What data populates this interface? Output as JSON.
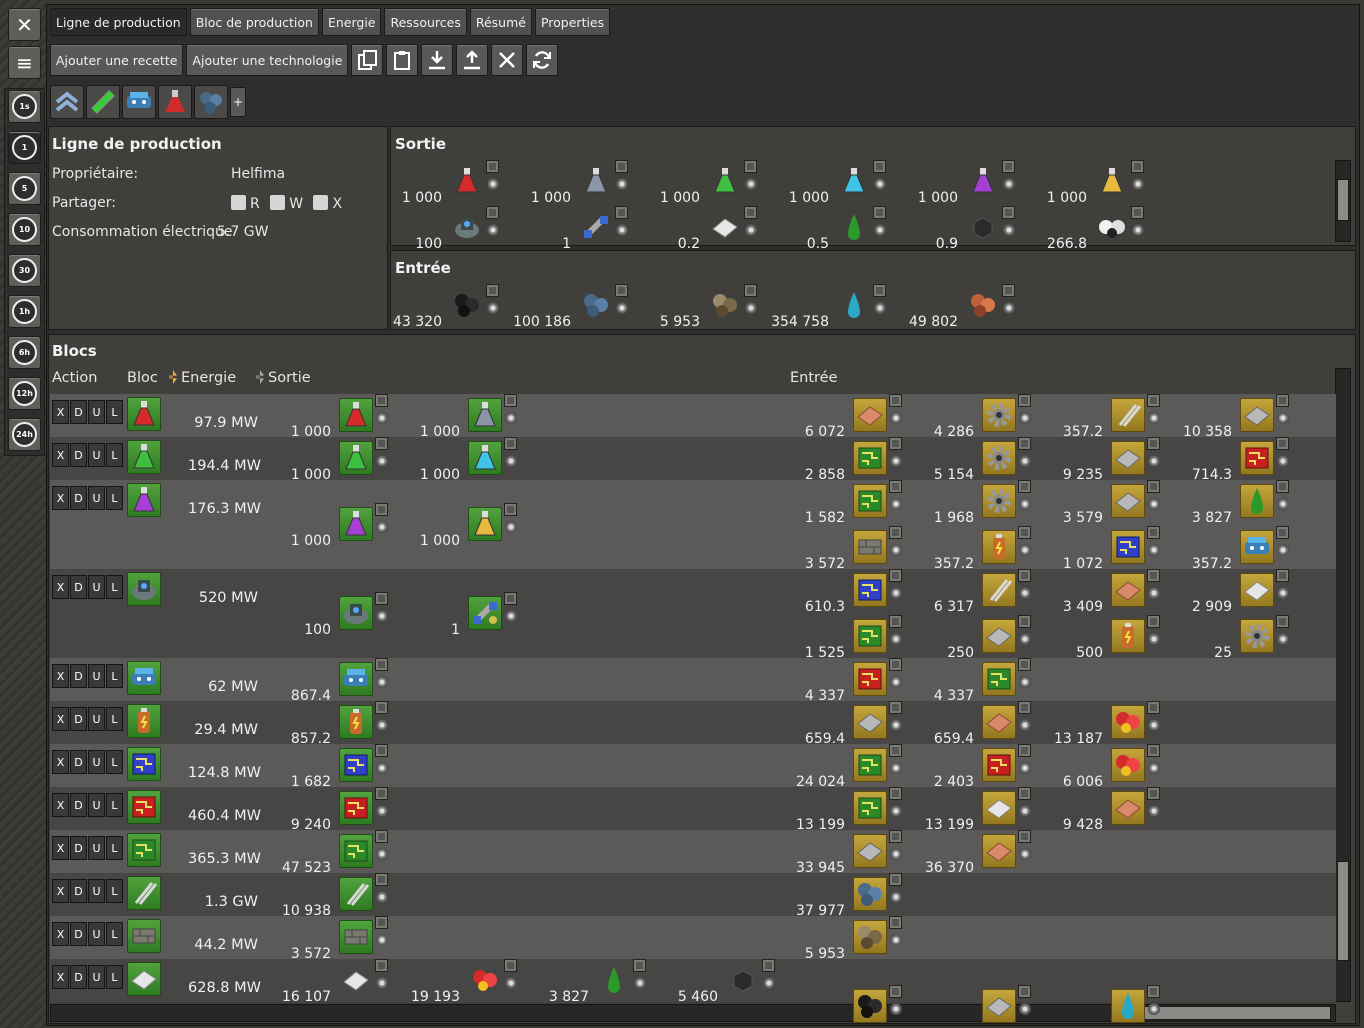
{
  "window": {
    "close_label": "✕",
    "menu_label": "≡"
  },
  "time_buttons": [
    "1s",
    "1",
    "5",
    "10",
    "30",
    "1h",
    "6h",
    "12h",
    "24h"
  ],
  "tabs": [
    "Ligne de production",
    "Bloc de production",
    "Energie",
    "Ressources",
    "Résumé",
    "Properties"
  ],
  "toolbar": {
    "add_recipe": "Ajouter une recette",
    "add_tech": "Ajouter une technologie",
    "plus": "+"
  },
  "info": {
    "title": "Ligne de production",
    "owner_label": "Propriétaire:",
    "owner_value": "Helfima",
    "share_label": "Partager:",
    "share_r": "R",
    "share_w": "W",
    "share_x": "X",
    "power_label": "Consommation électrique",
    "power_value": "5.7 GW"
  },
  "sortie": {
    "title": "Sortie",
    "items": [
      {
        "v": "1 000",
        "icon": "red-science-flask"
      },
      {
        "v": "1 000",
        "icon": "grey-science-flask"
      },
      {
        "v": "1 000",
        "icon": "green-science-flask"
      },
      {
        "v": "1 000",
        "icon": "cyan-science-flask"
      },
      {
        "v": "1 000",
        "icon": "purple-science-flask"
      },
      {
        "v": "1 000",
        "icon": "yellow-science-flask"
      },
      {
        "v": "100",
        "icon": "rocket-silo-icon"
      },
      {
        "v": "1",
        "icon": "satellite-icon"
      },
      {
        "v": "0.2",
        "icon": "steel-plate-icon"
      },
      {
        "v": "0.5",
        "icon": "green-droplet-icon"
      },
      {
        "v": "0.9",
        "icon": "dark-cube-icon"
      },
      {
        "v": "266.8",
        "icon": "white-balls-icon"
      }
    ]
  },
  "entree": {
    "title": "Entrée",
    "items": [
      {
        "v": "43 320",
        "icon": "coal-icon"
      },
      {
        "v": "100 186",
        "icon": "iron-ore-icon"
      },
      {
        "v": "5 953",
        "icon": "stone-icon"
      },
      {
        "v": "354 758",
        "icon": "water-droplet-icon"
      },
      {
        "v": "49 802",
        "icon": "copper-ore-icon"
      }
    ]
  },
  "blocs": {
    "title": "Blocs",
    "headers": {
      "action": "Action",
      "bloc": "Bloc",
      "energie": "Energie",
      "sortie": "Sortie",
      "entree": "Entrée"
    },
    "action_labels": [
      "X",
      "D",
      "U",
      "L"
    ],
    "rows": [
      {
        "icon": "red",
        "energy": "97.9 MW",
        "out": [
          [
            "1 000",
            "red"
          ],
          [
            "1 000",
            "grey"
          ]
        ],
        "in": [
          [
            "6 072",
            "copper"
          ],
          [
            "4 286",
            "gear"
          ],
          [
            "357.2",
            "rod"
          ],
          [
            "10 358",
            "plate"
          ]
        ]
      },
      {
        "icon": "green",
        "energy": "194.4 MW",
        "out": [
          [
            "1 000",
            "green"
          ],
          [
            "1 000",
            "cyan"
          ]
        ],
        "in": [
          [
            "2 858",
            "circuit"
          ],
          [
            "5 154",
            "gear"
          ],
          [
            "9 235",
            "plate"
          ],
          [
            "714.3",
            "redcirc"
          ]
        ]
      },
      {
        "icon": "purple",
        "energy": "176.3 MW",
        "out": [
          [
            "1 000",
            "purple"
          ],
          [
            "1 000",
            "yellow"
          ]
        ],
        "in": [
          [
            "1 582",
            "circuit"
          ],
          [
            "1 968",
            "gear"
          ],
          [
            "3 579",
            "plate"
          ],
          [
            "3 827",
            "greendrop"
          ],
          [
            "3 572",
            "brick"
          ],
          [
            "357.2",
            "battery"
          ],
          [
            "1 072",
            "bluecirc"
          ],
          [
            "357.2",
            "robot"
          ]
        ]
      },
      {
        "icon": "silo",
        "energy": "520 MW",
        "out": [
          [
            "100",
            "silo"
          ],
          [
            "1",
            "satellite"
          ]
        ],
        "in": [
          [
            "610.3",
            "bluecirc"
          ],
          [
            "6 317",
            "rod"
          ],
          [
            "3 409",
            "copper"
          ],
          [
            "2 909",
            "steel"
          ],
          [
            "1 525",
            "circuit"
          ],
          [
            "250",
            "plate"
          ],
          [
            "500",
            "battery"
          ],
          [
            "25",
            "gear"
          ]
        ]
      },
      {
        "icon": "robot",
        "energy": "62 MW",
        "out": [
          [
            "867.4",
            "robot"
          ]
        ],
        "in": [
          [
            "4 337",
            "redcirc"
          ],
          [
            "4 337",
            "circuit"
          ]
        ]
      },
      {
        "icon": "battery",
        "energy": "29.4 MW",
        "out": [
          [
            "857.2",
            "battery"
          ]
        ],
        "in": [
          [
            "659.4",
            "plate"
          ],
          [
            "659.4",
            "copper"
          ],
          [
            "13 187",
            "redballs"
          ]
        ]
      },
      {
        "icon": "bluecirc",
        "energy": "124.8 MW",
        "out": [
          [
            "1 682",
            "bluecirc"
          ]
        ],
        "in": [
          [
            "24 024",
            "circuit"
          ],
          [
            "2 403",
            "redcirc"
          ],
          [
            "6 006",
            "redballs"
          ]
        ]
      },
      {
        "icon": "redcirc",
        "energy": "460.4 MW",
        "out": [
          [
            "9 240",
            "redcirc"
          ]
        ],
        "in": [
          [
            "13 199",
            "circuit"
          ],
          [
            "13 199",
            "steel"
          ],
          [
            "9 428",
            "copper"
          ]
        ]
      },
      {
        "icon": "circuit",
        "energy": "365.3 MW",
        "out": [
          [
            "47 523",
            "circuit"
          ]
        ],
        "in": [
          [
            "33 945",
            "plate"
          ],
          [
            "36 370",
            "copper"
          ]
        ]
      },
      {
        "icon": "rod",
        "energy": "1.3 GW",
        "out": [
          [
            "10 938",
            "rod"
          ]
        ],
        "in": [
          [
            "37 977",
            "ironore"
          ]
        ]
      },
      {
        "icon": "brick",
        "energy": "44.2 MW",
        "out": [
          [
            "3 572",
            "brick"
          ]
        ],
        "in": [
          [
            "5 953",
            "stone"
          ]
        ]
      },
      {
        "icon": "steel",
        "energy": "628.8 MW",
        "out": [
          [
            "16 107",
            "steel"
          ],
          [
            "19 193",
            "redballs"
          ],
          [
            "3 827",
            "greendrop"
          ],
          [
            "5 460",
            "cube"
          ]
        ],
        "in": []
      }
    ]
  },
  "colors": {
    "panel": "#403f3c",
    "row_light": "#5b5a58",
    "row_dark": "#474644",
    "accent_green": "#3f8f30",
    "accent_gold": "#b8982f"
  }
}
